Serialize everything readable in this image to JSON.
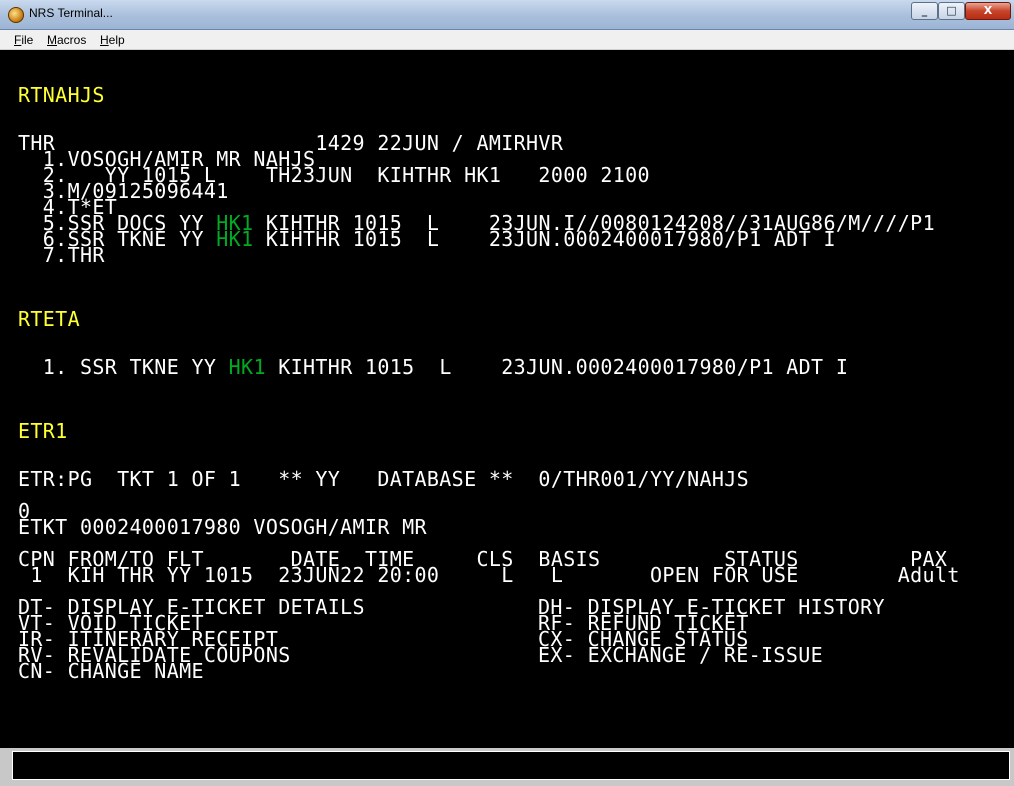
{
  "window": {
    "title": "NRS Terminal...",
    "icon": "app-logo-icon",
    "controls": {
      "minimize": "_",
      "maximize": "□",
      "close": "X"
    }
  },
  "menu": {
    "file": "File",
    "macros": "Macros",
    "help": "Help"
  },
  "terminal": {
    "cmd1": "RTNAHJS",
    "pnr": {
      "header": "THR                     1429 22JUN / AMIRHVR",
      "l1": "  1.VOSOGH/AMIR MR NAHJS",
      "l2": "  2.   YY 1015 L    TH23JUN  KIHTHR HK1   2000 2100",
      "l3": "  3.M/09125096441",
      "l4": "  4.T*ET",
      "l5": {
        "pre": "  5.SSR DOCS YY ",
        "status": "HK1",
        "post": " KIHTHR 1015  L    23JUN.I//0080124208//31AUG86/M////P1"
      },
      "l6": {
        "pre": "  6.SSR TKNE YY ",
        "status": "HK1",
        "post": " KIHTHR 1015  L    23JUN.0002400017980/P1 ADT I"
      },
      "l7": "  7.THR"
    },
    "cmd2": "RTETA",
    "eta": {
      "pre": "  1. SSR TKNE YY ",
      "status": "HK1",
      "post": " KIHTHR 1015  L    23JUN.0002400017980/P1 ADT I"
    },
    "cmd3": "ETR1",
    "etr": {
      "header": "ETR:PG  TKT 1 OF 1   ** YY   DATABASE **  0/THR001/YY/NAHJS",
      "zero": "0",
      "ticket": "ETKT 0002400017980 VOSOGH/AMIR MR",
      "col_header": "CPN FROM/TO FLT       DATE  TIME     CLS  BASIS          STATUS         PAX",
      "row1": " 1  KIH THR YY 1015  23JUN22 20:00     L   L       OPEN FOR USE        Adult"
    },
    "options": {
      "left": [
        "DT- DISPLAY E-TICKET DETAILS",
        "VT- VOID TICKET",
        "IR- ITINERARY RECEIPT",
        "RV- REVALIDATE COUPONS",
        "CN- CHANGE NAME"
      ],
      "right": [
        "DH- DISPLAY E-TICKET HISTORY",
        "RF- REFUND TICKET",
        "CX- CHANGE STATUS",
        "EX- EXCHANGE / RE-ISSUE"
      ]
    }
  },
  "command_input": {
    "value": ""
  },
  "colors": {
    "background": "#000000",
    "text": "#ffffff",
    "command": "#ffff33",
    "status_ok": "#00aa22"
  }
}
